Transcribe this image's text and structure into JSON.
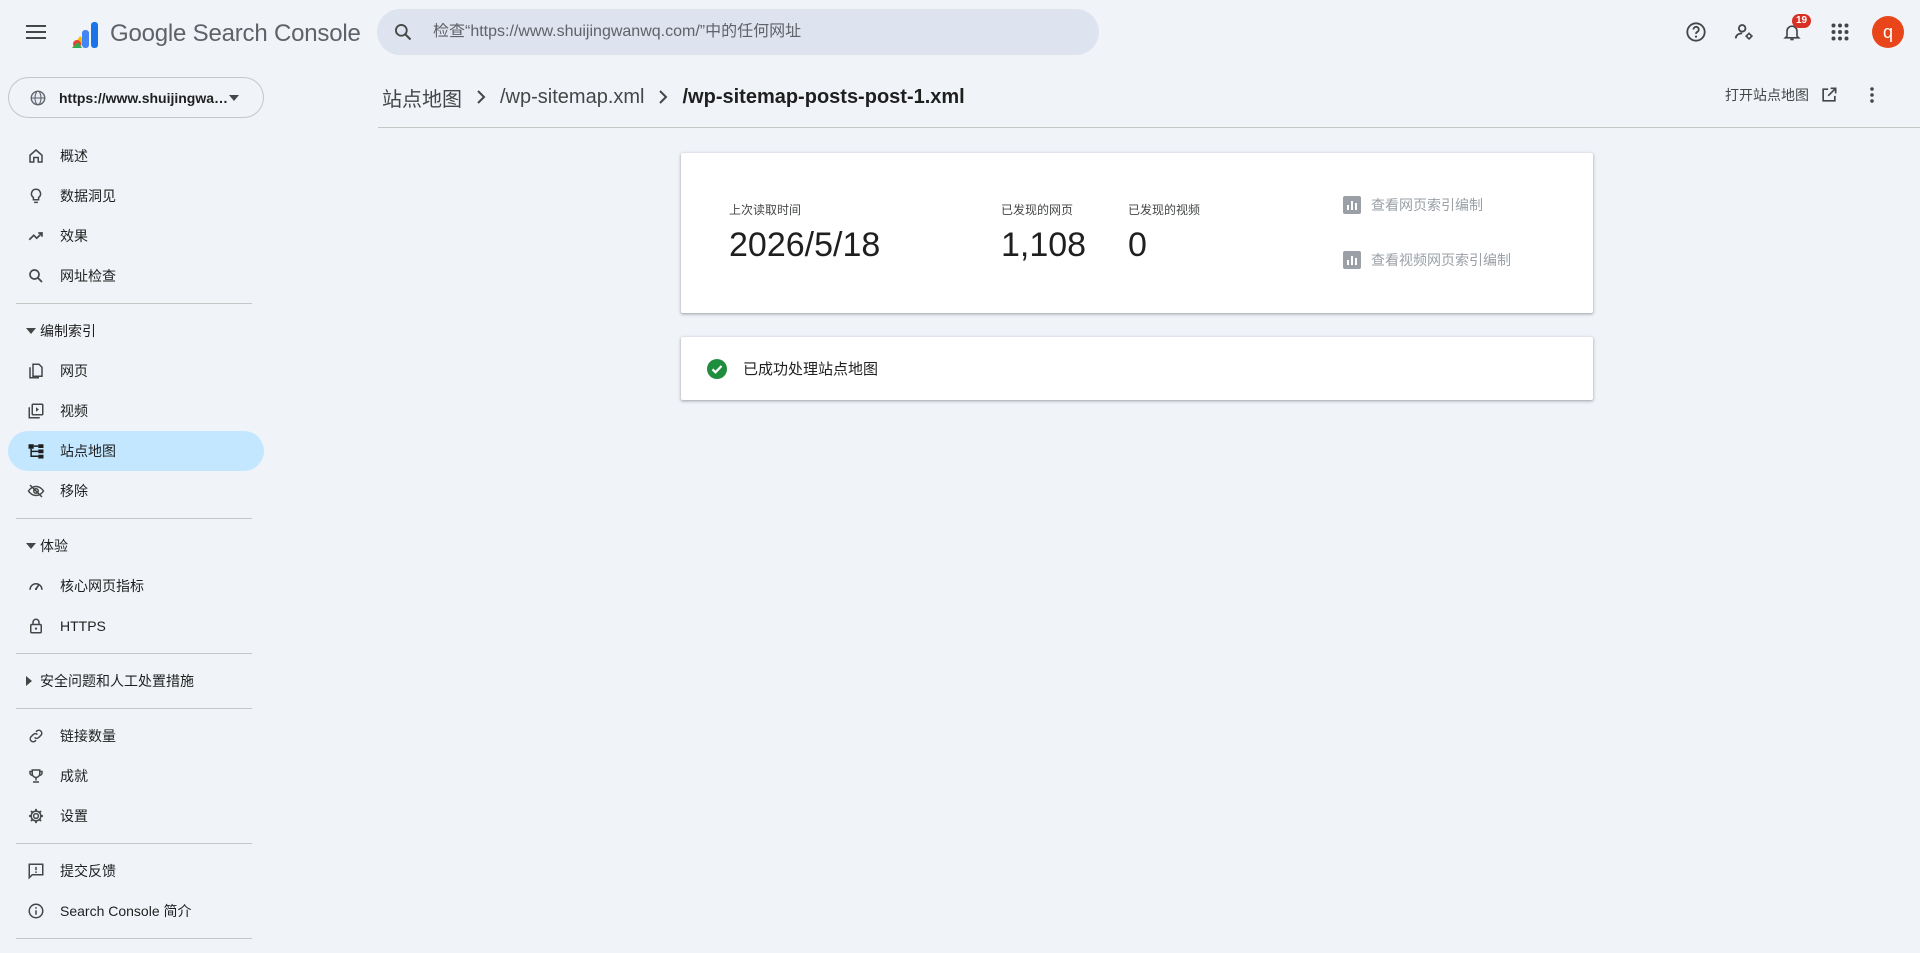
{
  "app": {
    "logo_text": "Google Search Console"
  },
  "search": {
    "placeholder": "检查“https://www.shuijingwanwq.com/”中的任何网址"
  },
  "topbar": {
    "notification_count": "19",
    "avatar_letter": "q"
  },
  "property": {
    "label": "https://www.shuijingwanwq.com/"
  },
  "sidebar": {
    "items": [
      {
        "label": "概述",
        "icon": "home-icon"
      },
      {
        "label": "数据洞见",
        "icon": "lightbulb-icon"
      },
      {
        "label": "效果",
        "icon": "trending-up-icon"
      },
      {
        "label": "网址检查",
        "icon": "search-icon"
      }
    ],
    "index_section": "编制索引",
    "index_items": [
      {
        "label": "网页",
        "icon": "pages-icon"
      },
      {
        "label": "视频",
        "icon": "video-icon"
      },
      {
        "label": "站点地图",
        "icon": "sitemap-icon",
        "active": true
      },
      {
        "label": "移除",
        "icon": "eye-off-icon"
      }
    ],
    "experience_section": "体验",
    "experience_items": [
      {
        "label": "核心网页指标",
        "icon": "speed-icon"
      },
      {
        "label": "HTTPS",
        "icon": "lock-icon"
      }
    ],
    "security_section": "安全问题和人工处置措施",
    "other_items": [
      {
        "label": "链接数量",
        "icon": "link-icon"
      },
      {
        "label": "成就",
        "icon": "trophy-icon"
      },
      {
        "label": "设置",
        "icon": "gear-icon"
      }
    ],
    "footer_items": [
      {
        "label": "提交反馈",
        "icon": "feedback-icon"
      },
      {
        "label": "Search Console 简介",
        "icon": "info-icon"
      }
    ]
  },
  "breadcrumb": {
    "root": "站点地图",
    "parent": "/wp-sitemap.xml",
    "current": "/wp-sitemap-posts-post-1.xml"
  },
  "header": {
    "open_sitemap_label": "打开站点地图"
  },
  "summary": {
    "last_read_label": "上次读取时间",
    "last_read_value": "2026/5/18",
    "pages_label": "已发现的网页",
    "pages_value": "1,108",
    "videos_label": "已发现的视频",
    "videos_value": "0",
    "page_index_link": "查看网页索引编制",
    "video_index_link": "查看视频网页索引编制"
  },
  "status": {
    "message": "已成功处理站点地图",
    "color": "#1e8e3e"
  },
  "colors": {
    "active_nav_bg": "#c2e7ff",
    "page_bg": "#f0f4f9",
    "badge": "#d93025",
    "avatar": "#e8461a"
  }
}
